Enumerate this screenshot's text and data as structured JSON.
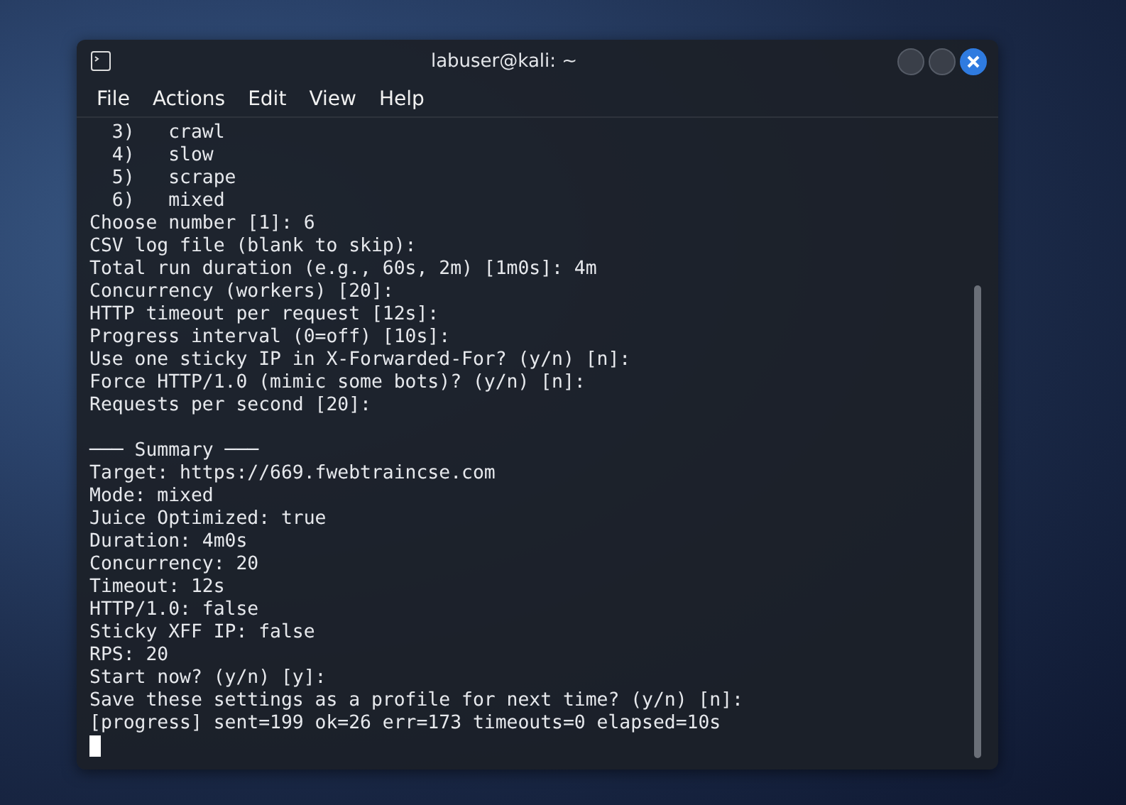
{
  "window": {
    "title": "labuser@kali: ~"
  },
  "menu": [
    "File",
    "Actions",
    "Edit",
    "View",
    "Help"
  ],
  "terminal": {
    "lines": [
      {
        "kind": "text",
        "text": "  3)   crawl"
      },
      {
        "kind": "text",
        "text": "  4)   slow"
      },
      {
        "kind": "text",
        "text": "  5)   scrape"
      },
      {
        "kind": "text",
        "text": "  6)   mixed"
      },
      {
        "kind": "text",
        "text": "Choose number [1]: 6"
      },
      {
        "kind": "text",
        "text": "CSV log file (blank to skip):"
      },
      {
        "kind": "text",
        "text": "Total run duration (e.g., 60s, 2m) [1m0s]: 4m"
      },
      {
        "kind": "text",
        "text": "Concurrency (workers) [20]:"
      },
      {
        "kind": "text",
        "text": "HTTP timeout per request [12s]:"
      },
      {
        "kind": "text",
        "text": "Progress interval (0=off) [10s]:"
      },
      {
        "kind": "text",
        "text": "Use one sticky IP in X-Forwarded-For? (y/n) [n]:"
      },
      {
        "kind": "text",
        "text": "Force HTTP/1.0 (mimic some bots)? (y/n) [n]:"
      },
      {
        "kind": "text",
        "text": "Requests per second [20]:"
      },
      {
        "kind": "blank"
      },
      {
        "kind": "text",
        "text": "─── Summary ───"
      },
      {
        "kind": "text",
        "text": "Target: https://669.fwebtraincse.com"
      },
      {
        "kind": "text",
        "text": "Mode: mixed"
      },
      {
        "kind": "text",
        "text": "Juice Optimized: true"
      },
      {
        "kind": "text",
        "text": "Duration: 4m0s"
      },
      {
        "kind": "text",
        "text": "Concurrency: 20"
      },
      {
        "kind": "text",
        "text": "Timeout: 12s"
      },
      {
        "kind": "text",
        "text": "HTTP/1.0: false"
      },
      {
        "kind": "text",
        "text": "Sticky XFF IP: false"
      },
      {
        "kind": "text",
        "text": "RPS: 20"
      },
      {
        "kind": "text",
        "text": "Start now? (y/n) [y]:"
      },
      {
        "kind": "text",
        "text": "Save these settings as a profile for next time? (y/n) [n]:"
      },
      {
        "kind": "text",
        "text": "[progress] sent=199 ok=26 err=173 timeouts=0 elapsed=10s"
      },
      {
        "kind": "cursor"
      }
    ]
  }
}
